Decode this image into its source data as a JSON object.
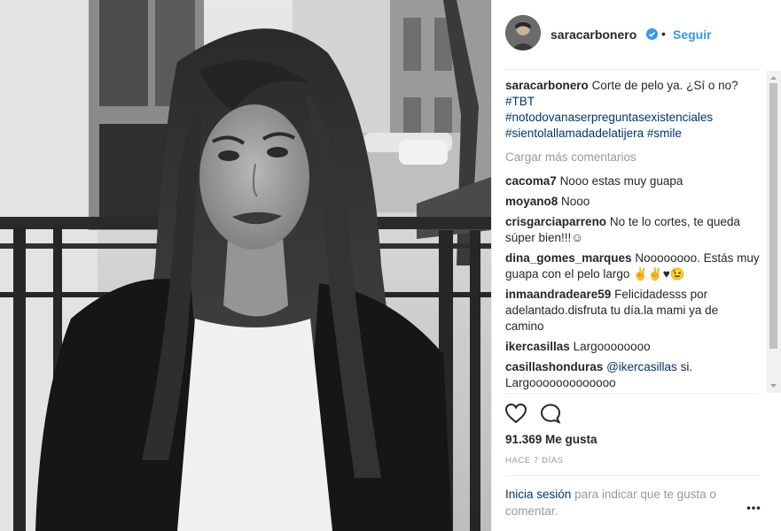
{
  "header": {
    "username": "saracarbonero",
    "separator": "•",
    "follow_label": "Seguir",
    "verified_icon": "verified-badge-icon"
  },
  "caption": {
    "username": "saracarbonero",
    "text": "Corte de pelo ya. ¿Sí o no?",
    "hashtags": [
      "#TBT",
      "#notodovanaserpreguntasexistenciales",
      "#sientolallamadadelatijera",
      "#smile"
    ]
  },
  "load_more_label": "Cargar más comentarios",
  "comments": [
    {
      "user": "cacoma7",
      "text": "Nooo estas muy guapa"
    },
    {
      "user": "moyano8",
      "text": "Nooo"
    },
    {
      "user": "crisgarciaparreno",
      "text": "No te lo cortes, te queda súper bien!!!☺"
    },
    {
      "user": "dina_gomes_marques",
      "text": "Noooooooo. Estás muy guapa con el pelo largo ✌✌♥😉"
    },
    {
      "user": "inmaandradeare59",
      "text": "Felicidadesss por adelantado.disfruta tu día.la mami ya de camino"
    },
    {
      "user": "ikercasillas",
      "text": "Largoooooooo"
    },
    {
      "user": "casillashonduras",
      "mention": "@ikercasillas",
      "text": "si. Largooooooooooooo"
    }
  ],
  "actions": {
    "like_icon": "heart-icon",
    "comment_icon": "comment-icon"
  },
  "likes_label": "91.369 Me gusta",
  "time_label": "HACE 7 DÍAS",
  "login": {
    "link": "Inicia sesión",
    "text": "para indicar que te gusta o comentar."
  },
  "colors": {
    "link": "#3897f0",
    "hashtag": "#003569",
    "muted": "#999999",
    "text": "#262626"
  }
}
